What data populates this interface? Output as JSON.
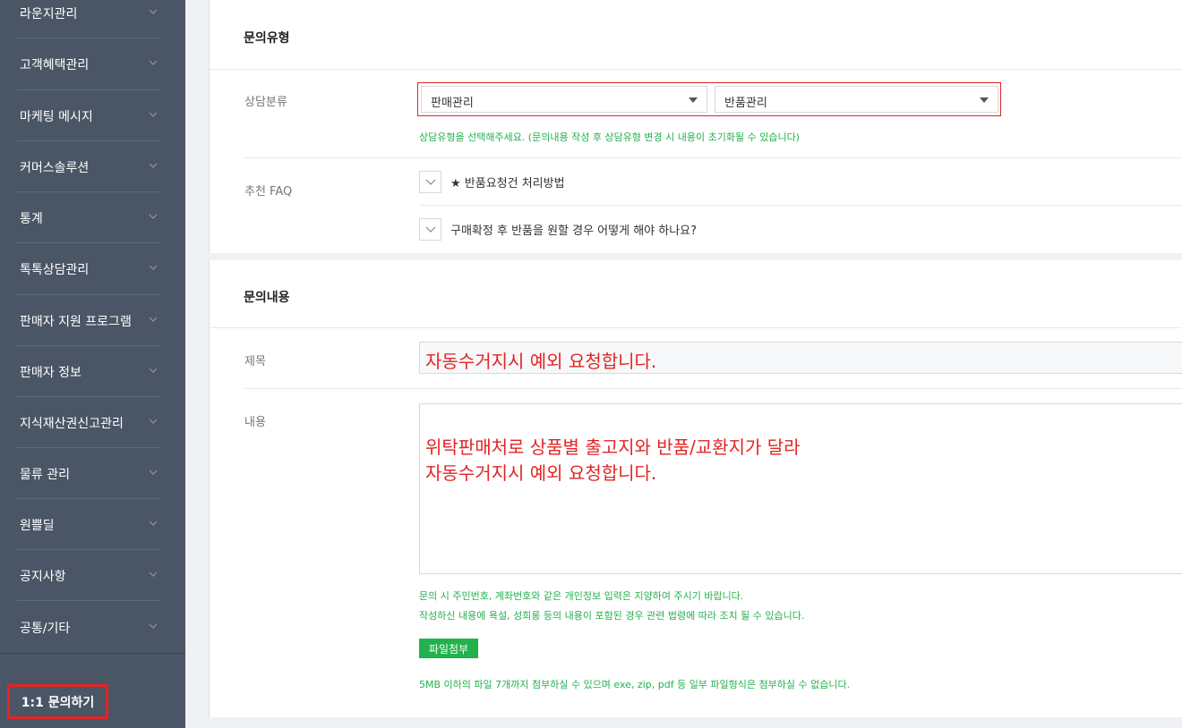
{
  "sidebar": {
    "items": [
      {
        "label": "라운지관리"
      },
      {
        "label": "고객혜택관리"
      },
      {
        "label": "마케팅 메시지"
      },
      {
        "label": "커머스솔루션"
      },
      {
        "label": "통계"
      },
      {
        "label": "톡톡상담관리"
      },
      {
        "label": "판매자 지원 프로그램"
      },
      {
        "label": "판매자 정보"
      },
      {
        "label": "지식재산권신고관리"
      },
      {
        "label": "물류 관리"
      },
      {
        "label": "원쁠딜"
      },
      {
        "label": "공지사항"
      },
      {
        "label": "공통/기타"
      }
    ],
    "inquiry_button": "1:1 문의하기"
  },
  "inquiry_type": {
    "title": "문의유형",
    "category_label": "상담분류",
    "select_primary": "판매관리",
    "select_secondary": "반품관리",
    "note": "상담유형을 선택해주세요. (문의내용 작성 후 상담유형 변경 시 내용이 초기화될 수 있습니다)",
    "faq_label": "추천 FAQ",
    "faq_items": [
      {
        "text": "★ 반품요청건 처리방법"
      },
      {
        "text": "구매확정 후 반품을 원할 경우 어떻게 해야 하나요?"
      }
    ]
  },
  "inquiry_content": {
    "title": "문의내용",
    "subject_label": "제목",
    "subject_value": "자동수거지시 예외 요청합니다.",
    "body_label": "내용",
    "body_lines": [
      "위탁판매처로 상품별 출고지와 반품/교환지가 달라",
      "자동수거지시 예외 요청합니다."
    ],
    "privacy_note": "문의 시 주민번호, 계좌번호와 같은 개인정보 입력은 지양하여 주시기 바랍니다.",
    "abuse_note": "작성하신 내용에 욕설, 성희롱 등의 내용이 포함된 경우 관련 법령에 따라 조치 될 수 있습니다.",
    "attach_button": "파일첨부",
    "attach_note": "5MB 이하의 파일 7개까지 첨부하실 수 있으며 exe, zip, pdf 등 일부 파일형식은 첨부하실 수 없습니다."
  },
  "colors": {
    "sidebar_bg": "#4a5666",
    "accent_green": "#23b14d",
    "highlight_red": "#e32424"
  }
}
